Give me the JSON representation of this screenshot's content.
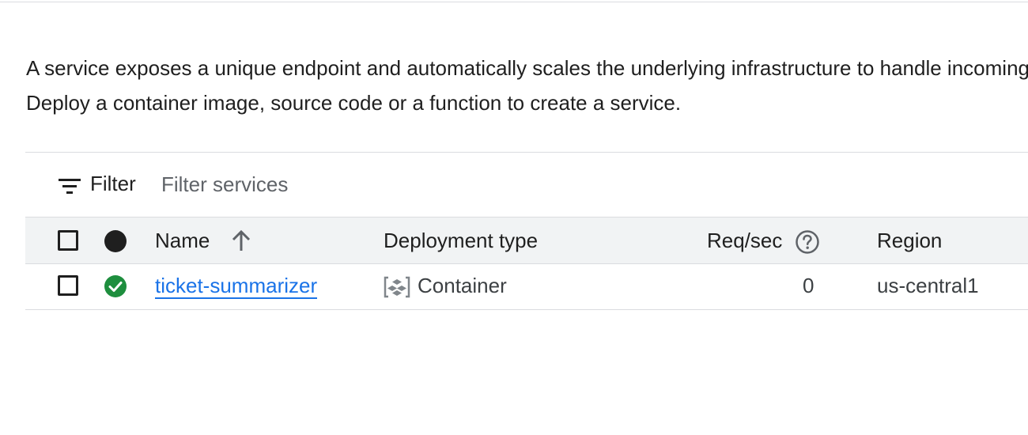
{
  "description": {
    "line1": "A service exposes a unique endpoint and automatically scales the underlying infrastructure to handle incoming requests.",
    "line2": "Deploy a container image, source code or a function to create a service."
  },
  "filter": {
    "label": "Filter",
    "placeholder": "Filter services",
    "value": "",
    "icon": "filter-icon"
  },
  "table": {
    "columns": {
      "name": "Name",
      "deployment_type": "Deployment type",
      "req_sec": "Req/sec",
      "region": "Region"
    },
    "sort": {
      "column": "Name",
      "direction": "ascending",
      "icon": "arrow-up-icon"
    },
    "rows": [
      {
        "status": "ok",
        "name": "ticket-summarizer",
        "deployment_type": "Container",
        "req_sec": "0",
        "region": "us-central1"
      }
    ]
  },
  "colors": {
    "link": "#1a73e8",
    "status_ok": "#1e8e3e",
    "header_bg": "#f1f3f4",
    "divider": "#dadce0"
  }
}
